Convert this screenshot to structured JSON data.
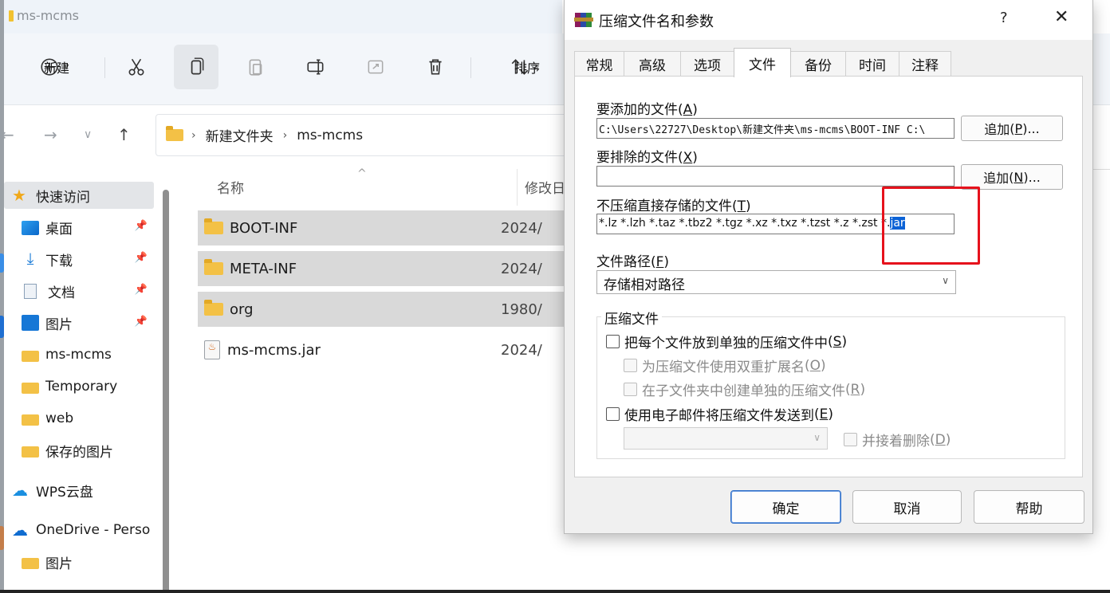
{
  "explorer": {
    "window_title": "ms-mcms",
    "toolbar": {
      "new_label": "新建",
      "sort_label": "排序"
    },
    "breadcrumb": [
      "新建文件夹",
      "ms-mcms"
    ],
    "sidebar": {
      "quick_access": "快速访问",
      "items": [
        {
          "label": "桌面",
          "pinned": true
        },
        {
          "label": "下载",
          "pinned": true
        },
        {
          "label": "文档",
          "pinned": true
        },
        {
          "label": "图片",
          "pinned": true
        },
        {
          "label": "ms-mcms",
          "pinned": false
        },
        {
          "label": "Temporary",
          "pinned": false
        },
        {
          "label": "web",
          "pinned": false
        },
        {
          "label": "保存的图片",
          "pinned": false
        }
      ],
      "wps": "WPS云盘",
      "onedrive": "OneDrive - Perso",
      "onedrive_child": "图片"
    },
    "columns": {
      "name": "名称",
      "modified": "修改日"
    },
    "files": [
      {
        "name": "BOOT-INF",
        "date": "2024/",
        "type": "folder",
        "selected": true
      },
      {
        "name": "META-INF",
        "date": "2024/",
        "type": "folder",
        "selected": true
      },
      {
        "name": "org",
        "date": "1980/",
        "type": "folder",
        "selected": true
      },
      {
        "name": "ms-mcms.jar",
        "date": "2024/",
        "type": "jar",
        "selected": false
      }
    ]
  },
  "dialog": {
    "title": "压缩文件名和参数",
    "help_glyph": "?",
    "close_glyph": "✕",
    "tabs": [
      "常规",
      "高级",
      "选项",
      "文件",
      "备份",
      "时间",
      "注释"
    ],
    "active_tab": "文件",
    "files_to_add": {
      "label": "要添加的文件",
      "accel": "A",
      "value": "C:\\Users\\22727\\Desktop\\新建文件夹\\ms-mcms\\BOOT-INF C:\\",
      "button": "追加",
      "button_accel": "P"
    },
    "files_to_exclude": {
      "label": "要排除的文件",
      "accel": "X",
      "value": "",
      "button": "追加",
      "button_accel": "N"
    },
    "store_without_compression": {
      "label": "不压缩直接存储的文件",
      "accel": "T",
      "value_prefix": "*.lz *.lzh *.taz *.tbz2 *.tgz *.xz *.txz *.tzst *.z *.zst *.",
      "value_selected": "jar"
    },
    "file_paths": {
      "label": "文件路径",
      "accel": "F",
      "selected": "存储相对路径"
    },
    "archive_group": {
      "title": "压缩文件",
      "put_each_file": {
        "label": "把每个文件放到单独的压缩文件中",
        "accel": "S",
        "checked": false
      },
      "double_ext": {
        "label": "为压缩文件使用双重扩展名",
        "accel": "O",
        "checked": false,
        "enabled": false
      },
      "separate_subfolders": {
        "label": "在子文件夹中创建单独的压缩文件",
        "accel": "R",
        "checked": false,
        "enabled": false
      },
      "send_email": {
        "label": "使用电子邮件将压缩文件发送到",
        "accel": "E",
        "checked": false
      },
      "delete_after": {
        "label": "并接着删除",
        "accel": "D",
        "checked": false,
        "enabled": false
      }
    },
    "buttons": {
      "ok": "确定",
      "cancel": "取消",
      "help": "帮助"
    }
  },
  "annotation": {
    "color": "#e6121c"
  }
}
